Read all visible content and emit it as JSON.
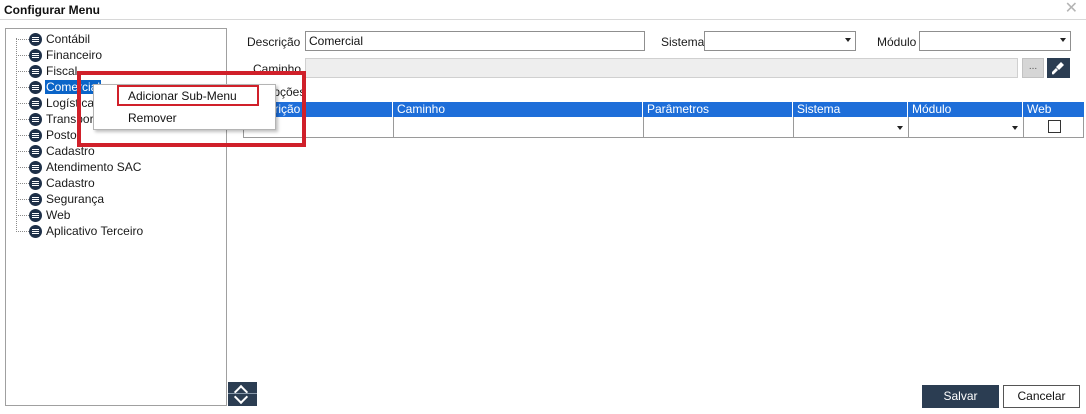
{
  "window": {
    "title": "Configurar Menu",
    "close_glyph": "✕"
  },
  "tree": {
    "items": [
      {
        "label": "Contábil"
      },
      {
        "label": "Financeiro"
      },
      {
        "label": "Fiscal"
      },
      {
        "label": "Comercial"
      },
      {
        "label": "Logística"
      },
      {
        "label": "Transporte"
      },
      {
        "label": "Posto"
      },
      {
        "label": "Cadastro"
      },
      {
        "label": "Atendimento SAC"
      },
      {
        "label": "Cadastro"
      },
      {
        "label": "Segurança"
      },
      {
        "label": "Web"
      },
      {
        "label": "Aplicativo Terceiro"
      }
    ],
    "selected_index": 3
  },
  "form": {
    "descricao_label": "Descrição",
    "descricao_value": "Comercial",
    "sistema_label": "Sistema",
    "sistema_value": "",
    "modulo_label": "Módulo",
    "modulo_value": "",
    "caminho_label": "Caminho",
    "caminho_value": "",
    "browse_label": "...",
    "opcoes_label": "Opções"
  },
  "grid": {
    "columns": [
      "Descrição",
      "Caminho",
      "Parâmetros",
      "Sistema",
      "Módulo",
      "Web"
    ],
    "rows": [
      {
        "descricao": "",
        "caminho": "",
        "parametros": "",
        "sistema": "",
        "modulo": "",
        "web": false
      }
    ]
  },
  "context_menu": {
    "items": [
      "Adicionar Sub-Menu",
      "Remover"
    ]
  },
  "footer": {
    "salvar_label": "Salvar",
    "cancelar_label": "Cancelar"
  },
  "colors": {
    "accent": "#1e6ed9",
    "selection": "#0a64c8",
    "dark_button": "#2b3d52",
    "highlight": "#d0202a"
  }
}
